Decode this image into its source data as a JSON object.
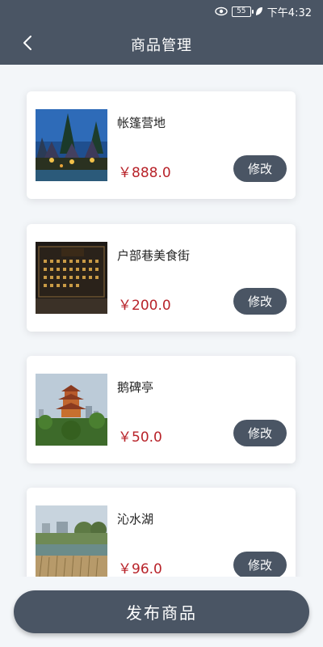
{
  "status_bar": {
    "battery": "55",
    "time": "下午4:32",
    "icons": [
      "eye-icon",
      "battery-icon",
      "leaf-icon"
    ]
  },
  "header": {
    "title": "商品管理",
    "back_icon": "chevron-left-icon"
  },
  "products": [
    {
      "name": "帐篷营地",
      "price": "￥888.0",
      "edit_label": "修改",
      "image": "tent-camp-photo"
    },
    {
      "name": "户部巷美食街",
      "price": "￥200.0",
      "edit_label": "修改",
      "image": "food-street-sign-photo"
    },
    {
      "name": "鹅碑亭",
      "price": "￥50.0",
      "edit_label": "修改",
      "image": "pagoda-tower-photo"
    },
    {
      "name": "沁水湖",
      "price": "￥96.0",
      "edit_label": "修改",
      "image": "lake-photo"
    }
  ],
  "footer": {
    "publish_label": "发布商品"
  },
  "colors": {
    "primary": "#4a5564",
    "price": "#b8232a",
    "background": "#f3f6f9"
  }
}
